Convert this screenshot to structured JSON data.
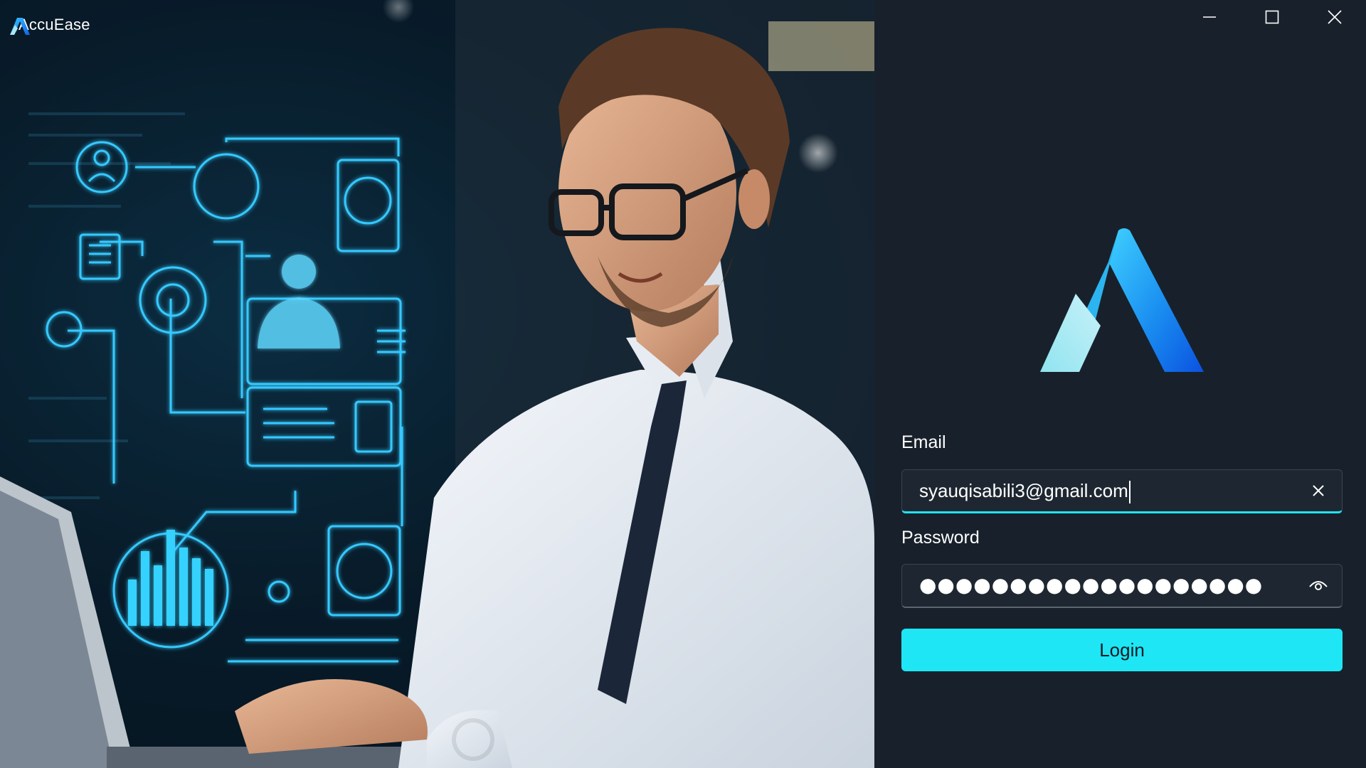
{
  "app": {
    "title": "AccuEase",
    "logo_icon": "accuease-a-logo-icon"
  },
  "window_controls": {
    "minimize_icon": "minimize-icon",
    "maximize_icon": "maximize-icon",
    "close_icon": "close-icon"
  },
  "login": {
    "email_label": "Email",
    "email_value": "syauqisabili3@gmail.com",
    "password_label": "Password",
    "password_masked": "●●●●●●●●●●●●●●●●●●●",
    "clear_icon": "clear-x-icon",
    "reveal_icon": "eye-icon",
    "login_label": "Login"
  },
  "hero": {
    "icons": [
      "user-icon",
      "handshake-icon",
      "lightbulb-icon",
      "document-icon",
      "gear-icon",
      "building-icon",
      "profile-card-icon",
      "bar-chart-icon"
    ]
  },
  "colors": {
    "panel_bg": "#18212b",
    "accent_cyan": "#1ee6f5",
    "input_bg": "#1e2731",
    "hero_glow": "#2ec8ff"
  }
}
